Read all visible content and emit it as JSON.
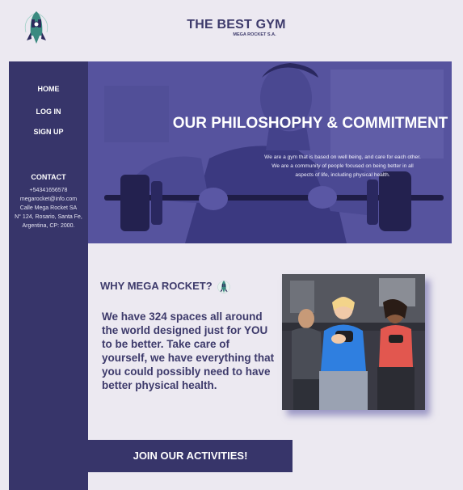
{
  "header": {
    "title": "THE BEST GYM",
    "subtitle": "MEGA ROCKET S.A.",
    "logo_icon": "rocket-logo-icon"
  },
  "sidebar": {
    "items": [
      {
        "label": "HOME"
      },
      {
        "label": "LOG IN"
      },
      {
        "label": "SIGN UP"
      }
    ],
    "contact": {
      "heading": "CONTACT",
      "lines": [
        "+54341656578",
        "megarocket@info.com",
        "Calle Mega Rocket SA",
        "N° 124, Rosario, Santa Fe,",
        "Argentina, CP: 2000."
      ]
    }
  },
  "hero": {
    "title": "OUR PHILOSHOPHY & COMMITMENT",
    "lines": [
      "We are a gym that is based on well being, and care for each other.",
      "We are a community of people focused on  being better in all",
      "aspects of life, including physical health."
    ]
  },
  "why": {
    "title": "WHY MEGA ROCKET?",
    "icon": "rocket-icon",
    "body": "We have 324 spaces all around the world designed just for YOU to be better. Take care of yourself, we have everything that you could possibly need to have better physical health."
  },
  "cta": {
    "label": "JOIN OUR ACTIVITIES!"
  },
  "colors": {
    "background": "#ece9f1",
    "primary": "#37356a",
    "hero_overlay": "#5956a2",
    "accent_teal": "#3a8a80"
  }
}
